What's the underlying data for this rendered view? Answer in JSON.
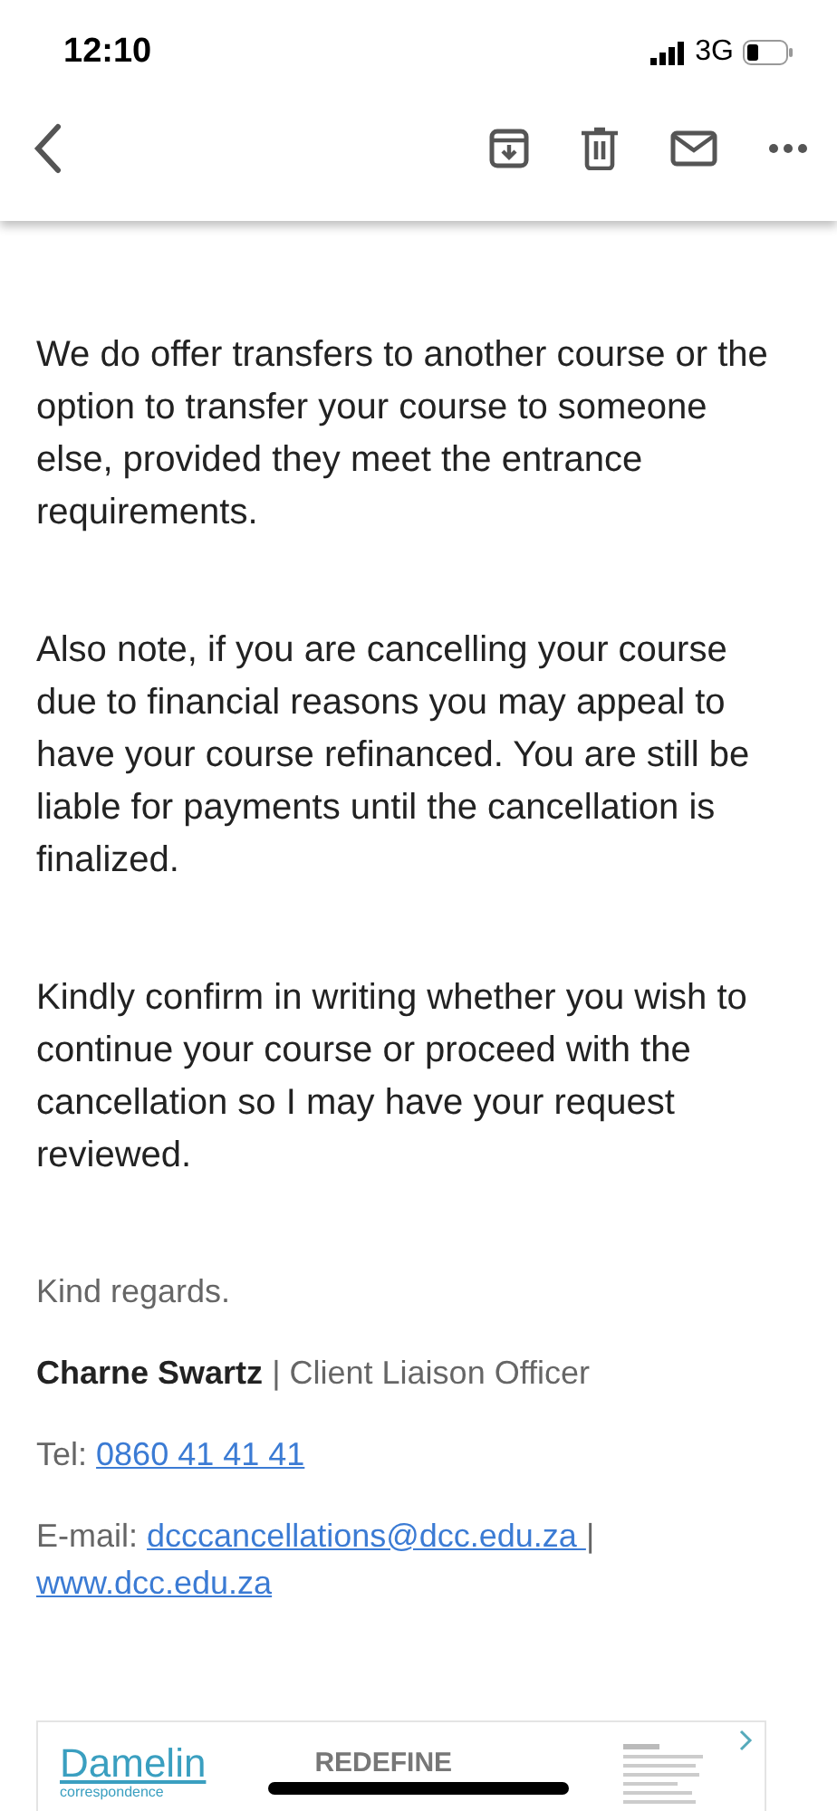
{
  "status_bar": {
    "time": "12:10",
    "network": "3G"
  },
  "paragraphs": [
    "We do offer transfers to another course or the option to transfer your course to someone else, provided they meet the entrance requirements.",
    "Also note, if you are cancelling your course due to financial reasons you may appeal to have your course refinanced. You are still be liable for payments until the cancellation is finalized.",
    "Kindly confirm in writing whether you wish to continue your course or proceed with the cancellation so I may have your request reviewed."
  ],
  "signature": {
    "closing": "Kind regards.",
    "name": "Charne Swartz",
    "separator": "|",
    "title": "Client Liaison Officer",
    "tel_label": "Tel:",
    "tel": "0860 41 41 41",
    "email_label": "E-mail:",
    "email": "dcccancellations@dcc.edu.za ",
    "email_separator": "|",
    "website": "www.dcc.edu.za"
  },
  "banner": {
    "logo": "Damelin",
    "logo_sub": "correspondence",
    "headline": "REDEFINE"
  }
}
